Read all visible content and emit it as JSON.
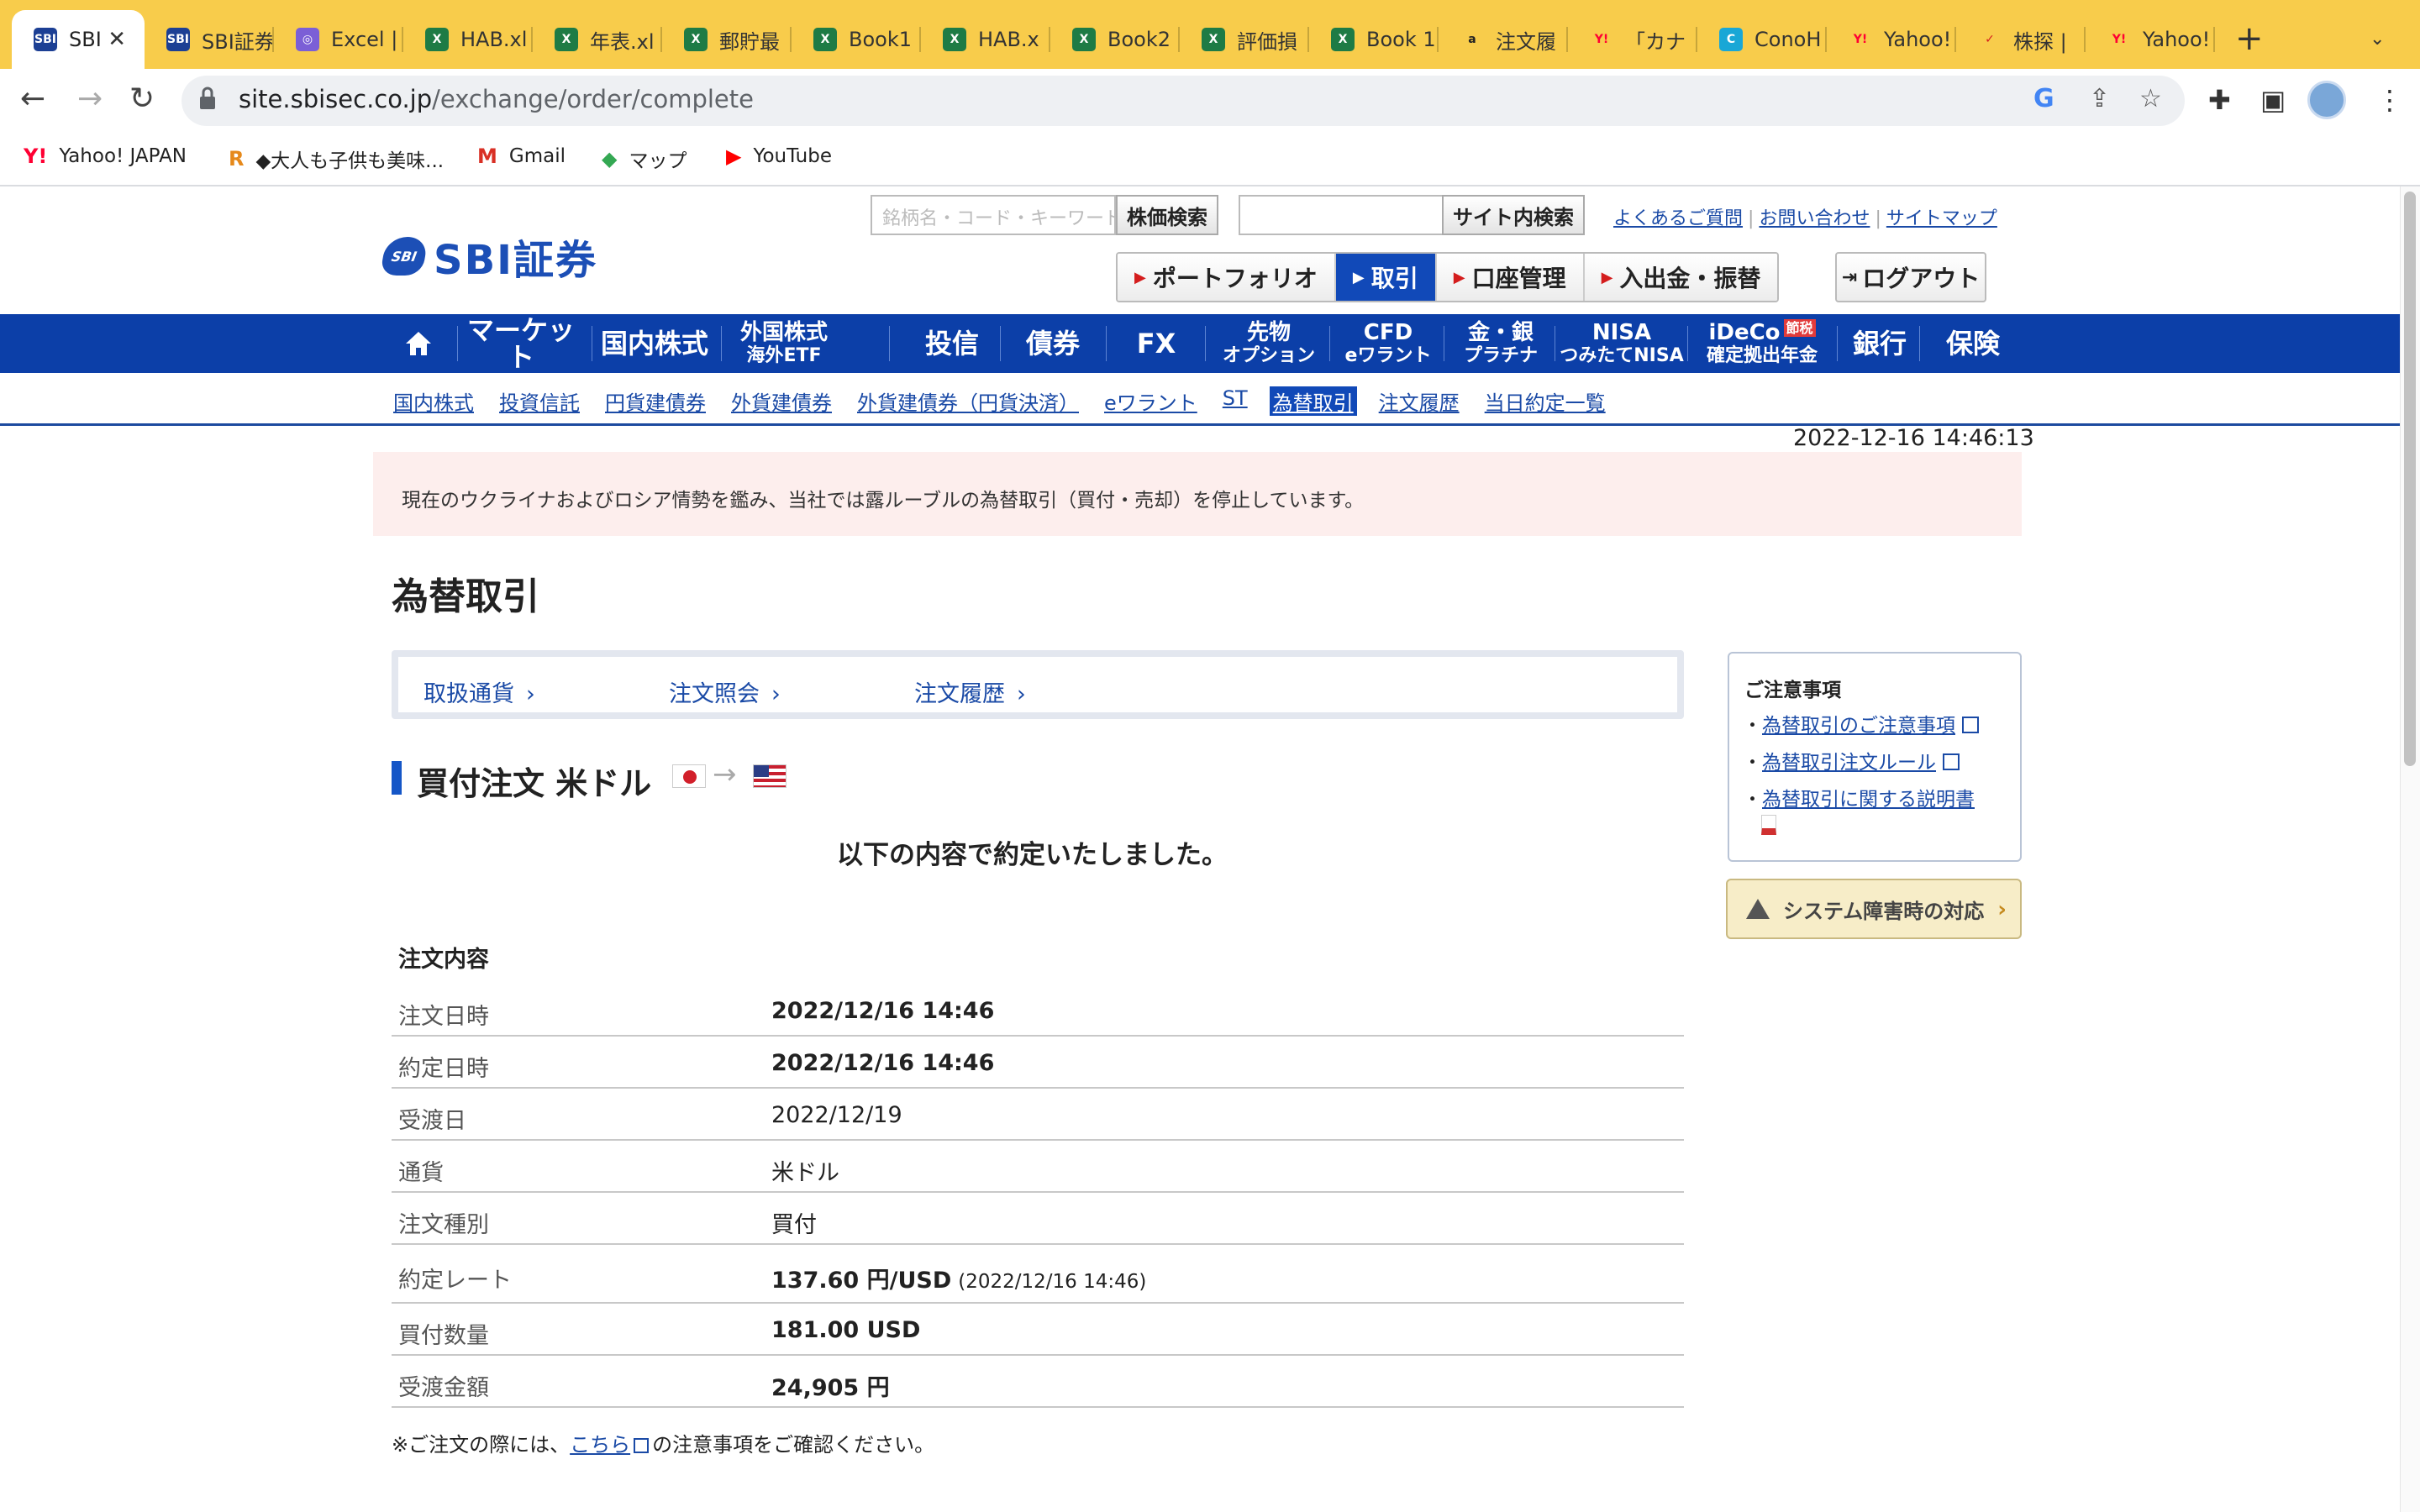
{
  "browser": {
    "tabs": [
      {
        "title": "SBI",
        "favicon": "SBI",
        "color": "#1c3f94"
      },
      {
        "title": "SBI証券",
        "favicon": "SBI",
        "color": "#1c3f94"
      },
      {
        "title": "Excel |",
        "favicon": "◎",
        "color": "#7b5fd6"
      },
      {
        "title": "HAB.xl",
        "favicon": "X",
        "color": "#1e7b45"
      },
      {
        "title": "年表.xl",
        "favicon": "X",
        "color": "#1e7b45"
      },
      {
        "title": "郵貯最",
        "favicon": "X",
        "color": "#1e7b45"
      },
      {
        "title": "Book1",
        "favicon": "X",
        "color": "#1e7b45"
      },
      {
        "title": "HAB.x",
        "favicon": "X",
        "color": "#1e7b45"
      },
      {
        "title": "Book2",
        "favicon": "X",
        "color": "#1e7b45"
      },
      {
        "title": "評価損",
        "favicon": "X",
        "color": "#1e7b45"
      },
      {
        "title": "Book 1",
        "favicon": "X",
        "color": "#1e7b45"
      },
      {
        "title": "注文履",
        "favicon": "a",
        "color": "#222222"
      },
      {
        "title": "「カナ",
        "favicon": "Y!",
        "color": "#ff0033"
      },
      {
        "title": "ConoH",
        "favicon": "C",
        "color": "#19a7d6"
      },
      {
        "title": "Yahoo!",
        "favicon": "Y!",
        "color": "#ff0033"
      },
      {
        "title": "株探 |",
        "favicon": "✓",
        "color": "#d41d1d"
      },
      {
        "title": "Yahoo!",
        "favicon": "Y!",
        "color": "#ff0033"
      }
    ],
    "close_glyph": "✕",
    "new_tab_glyph": "+",
    "tab_menu_glyph": "⌄",
    "url_host": "site.sbisec.co.jp",
    "url_path": "/exchange/order/complete",
    "bookmarks": [
      {
        "label": "Yahoo! JAPAN",
        "icon": "Y!",
        "color": "#ff0033"
      },
      {
        "label": "◆大人も子供も美味...",
        "icon": "R",
        "color": "#e6891b"
      },
      {
        "label": "Gmail",
        "icon": "M",
        "color": "#d93025"
      },
      {
        "label": "マップ",
        "icon": "◆",
        "color": "#34a853"
      },
      {
        "label": "YouTube",
        "icon": "▶",
        "color": "#ff0000"
      }
    ]
  },
  "site": {
    "logo_mark": "SBI",
    "logo_text": "SBI証券",
    "stock_search_placeholder": "銘柄名・コード・キーワード",
    "stock_search_button": "株価検索",
    "site_search_button": "サイト内検索",
    "top_links": [
      "よくあるご質問",
      "お問い合わせ",
      "サイトマップ"
    ],
    "main_buttons": [
      "ポートフォリオ",
      "取引",
      "口座管理",
      "入出金・振替"
    ],
    "logout": "ログアウト",
    "gnav": [
      {
        "l1": "マーケット"
      },
      {
        "l1": "国内株式"
      },
      {
        "l1": "外国株式",
        "l2": "海外ETF"
      },
      {
        "l1": "投信"
      },
      {
        "l1": "債券"
      },
      {
        "l1": "FX"
      },
      {
        "l1": "先物",
        "l2": "オプション"
      },
      {
        "l1": "CFD",
        "l2": "eワラント"
      },
      {
        "l1": "金・銀",
        "l2": "プラチナ"
      },
      {
        "l1": "NISA",
        "l2": "つみたてNISA"
      },
      {
        "l1": "iDeCo",
        "badge": "節税",
        "l2": "確定拠出年金"
      },
      {
        "l1": "銀行"
      },
      {
        "l1": "保険"
      }
    ],
    "subnav": [
      "国内株式",
      "投資信託",
      "円貨建債券",
      "外貨建債券",
      "外貨建債券（円貨決済）",
      "eワラント",
      "ST",
      "為替取引",
      "注文履歴",
      "当日約定一覧"
    ],
    "timestamp": "2022-12-16 14:46:13",
    "notice": "現在のウクライナおよびロシア情勢を鑑み、当社では露ルーブルの為替取引（買付・売却）を停止しています。"
  },
  "main": {
    "title": "為替取引",
    "tabs": [
      "取扱通貨",
      "注文照会",
      "注文履歴"
    ],
    "order_heading": "買付注文 米ドル",
    "confirm_message": "以下の内容で約定いたしました。",
    "section_title": "注文内容",
    "rows": [
      {
        "label": "注文日時",
        "value": "2022/12/16 14:46",
        "bold": true
      },
      {
        "label": "約定日時",
        "value": "2022/12/16 14:46",
        "bold": true
      },
      {
        "label": "受渡日",
        "value": "2022/12/19",
        "bold": false
      },
      {
        "label": "通貨",
        "value": "米ドル",
        "bold": false
      },
      {
        "label": "注文種別",
        "value": "買付",
        "bold": false
      },
      {
        "label": "約定レート",
        "value": "137.60 円/USD",
        "note": "(2022/12/16 14:46)",
        "bold": true
      },
      {
        "label": "買付数量",
        "value": "181.00 USD",
        "bold": true
      },
      {
        "label": "受渡金額",
        "value": "24,905 円",
        "bold": true
      }
    ],
    "footnote_prefix": "※ご注文の際には、",
    "footnote_link": "こちら",
    "footnote_suffix": "の注意事項をご確認ください。"
  },
  "sidebar": {
    "title": "ご注意事項",
    "links": [
      "為替取引のご注意事項",
      "為替取引注文ルール",
      "為替取引に関する説明書"
    ],
    "system_button": "システム障害時の対応"
  }
}
